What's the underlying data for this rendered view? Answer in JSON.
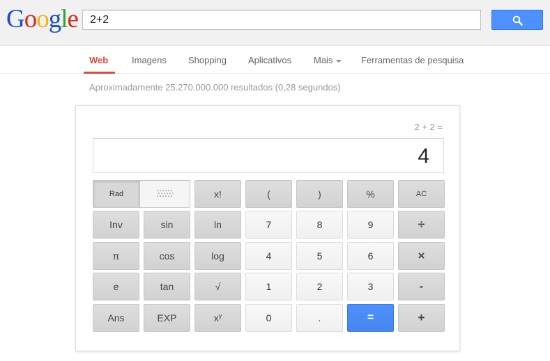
{
  "header": {
    "logo_letters": [
      "G",
      "o",
      "o",
      "g",
      "l",
      "e"
    ],
    "logo_colors": [
      "#1a4fc7",
      "#d52a1e",
      "#f2b40c",
      "#1a4fc7",
      "#28a52c",
      "#d52a1e"
    ],
    "search_value": "2+2",
    "search_button_icon": "magnifier-icon",
    "accent": "#4d90fe"
  },
  "nav": {
    "items": [
      "Web",
      "Imagens",
      "Shopping",
      "Aplicativos",
      "Mais",
      "Ferramentas de pesquisa"
    ],
    "active_color": "#dd4b39"
  },
  "stats": "Aproximadamente 25.270.000.000 resultados (0,28 segundos)",
  "calculator": {
    "expression": "2 + 2 =",
    "result": "4",
    "mode_rad": "Rad",
    "mode_deg_icon": "dotted-grid-icon",
    "keys": {
      "fact": "x!",
      "lparen": "(",
      "rparen": ")",
      "percent": "%",
      "ac": "AC",
      "inv": "Inv",
      "sin": "sin",
      "ln": "ln",
      "k7": "7",
      "k8": "8",
      "k9": "9",
      "div": "÷",
      "pi": "π",
      "cos": "cos",
      "log": "log",
      "k4": "4",
      "k5": "5",
      "k6": "6",
      "mul": "×",
      "e": "e",
      "tan": "tan",
      "sqrt": "√",
      "k1": "1",
      "k2": "2",
      "k3": "3",
      "sub": "-",
      "ans": "Ans",
      "exp": "EXP",
      "pow_base": "x",
      "pow_exp": "y",
      "k0": "0",
      "dot": ".",
      "eq": "=",
      "add": "+"
    }
  }
}
